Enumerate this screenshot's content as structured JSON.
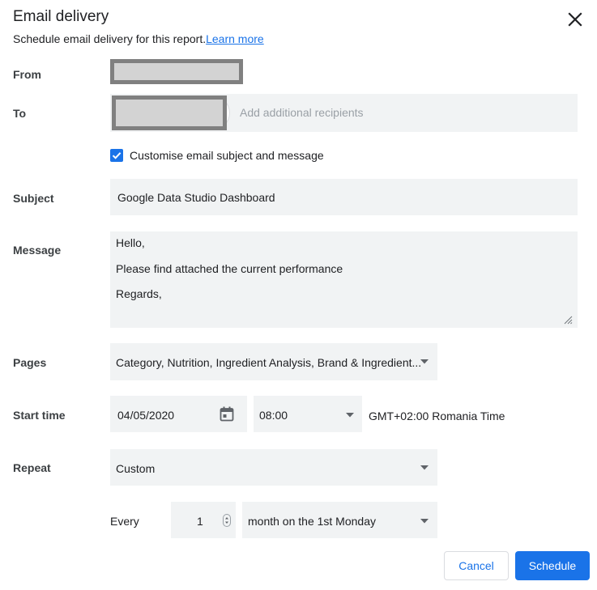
{
  "dialog": {
    "title": "Email delivery",
    "subtitle": "Schedule email delivery for this report.",
    "learn_more": "Learn more"
  },
  "labels": {
    "from": "From",
    "to": "To",
    "subject": "Subject",
    "message": "Message",
    "pages": "Pages",
    "start_time": "Start time",
    "repeat": "Repeat"
  },
  "to": {
    "placeholder": "Add additional recipients"
  },
  "customise": {
    "checked": true,
    "label": "Customise email subject and message"
  },
  "subject": {
    "value": "Google Data Studio Dashboard"
  },
  "message": {
    "lines": [
      "Hello,",
      "Please find attached the current performance",
      "Regards,"
    ]
  },
  "pages": {
    "value": "Category, Nutrition, Ingredient Analysis, Brand & Ingredient..."
  },
  "start_time": {
    "date": "04/05/2020",
    "time": "08:00",
    "timezone": "GMT+02:00 Romania Time"
  },
  "repeat": {
    "value": "Custom",
    "every_label": "Every",
    "every_count": "1",
    "interval": "month on the 1st Monday"
  },
  "buttons": {
    "cancel": "Cancel",
    "schedule": "Schedule"
  },
  "colors": {
    "accent": "#1a73e8",
    "field_bg": "#f1f3f4",
    "redaction_fill": "#d3d3d3",
    "redaction_border": "#808080"
  },
  "icons": {
    "close": "close-icon",
    "checkbox": "checkmark-icon",
    "calendar": "calendar-icon",
    "dropdown": "arrow-drop-down-icon",
    "stepper": "spinner-icon",
    "resize": "resize-handle-icon"
  }
}
